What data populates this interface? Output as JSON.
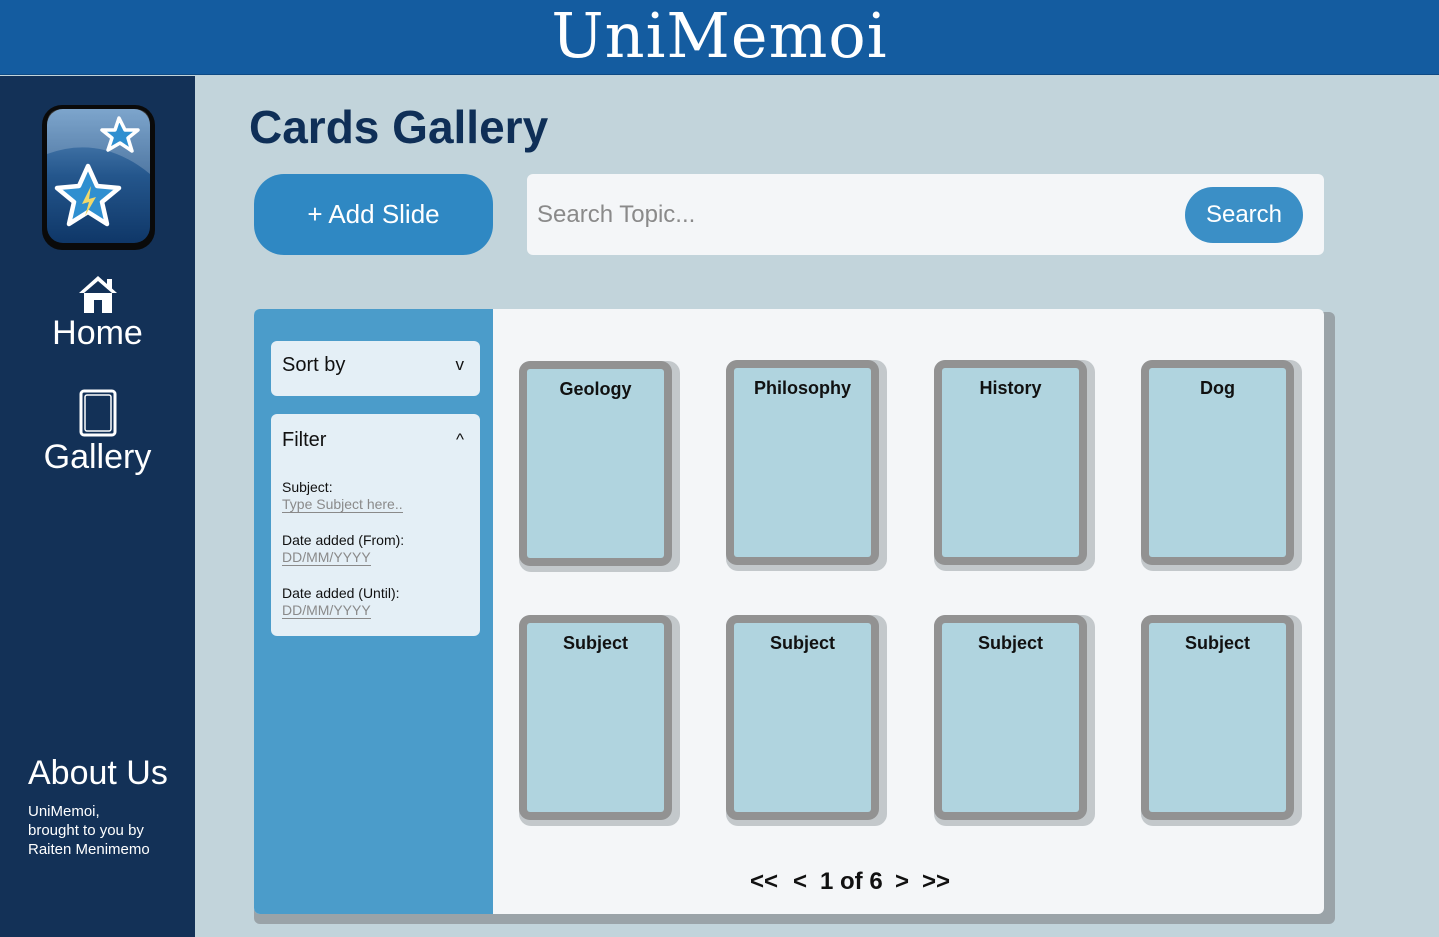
{
  "app": {
    "title": "UniMemoi"
  },
  "sidebar": {
    "items": [
      {
        "label": "Home",
        "icon": "home-icon"
      },
      {
        "label": "Gallery",
        "icon": "card-icon"
      }
    ],
    "about_title": "About Us",
    "about_lines": [
      "UniMemoi,",
      "brought to you by",
      "Raiten Menimemo"
    ]
  },
  "main": {
    "title": "Cards Gallery",
    "add_button": "+ Add Slide",
    "search": {
      "placeholder": "Search Topic...",
      "value": "",
      "button": "Search"
    }
  },
  "filters": {
    "sort_label": "Sort by",
    "sort_chevron": "v",
    "filter_label": "Filter",
    "filter_chevron": "^",
    "subject_label": "Subject:",
    "subject_placeholder": "Type Subject here..",
    "date_from_label": "Date added (From):",
    "date_from_placeholder": "DD/MM/YYYY",
    "date_until_label": "Date added (Until):",
    "date_until_placeholder": "DD/MM/YYYY"
  },
  "cards": [
    {
      "title": "Geology"
    },
    {
      "title": "Philosophy"
    },
    {
      "title": "History"
    },
    {
      "title": "Dog"
    },
    {
      "title": "Subject"
    },
    {
      "title": "Subject"
    },
    {
      "title": "Subject"
    },
    {
      "title": "Subject"
    }
  ],
  "pagination": {
    "first": "<<",
    "prev": "<",
    "current": "1 of 6",
    "next": ">",
    "last": ">>"
  },
  "colors": {
    "header": "#145ca0",
    "sidebar": "#133157",
    "page_background": "#c2d4db",
    "accent": "#2f88c3",
    "card_face": "#b0d4df",
    "card_frame": "#929292"
  }
}
